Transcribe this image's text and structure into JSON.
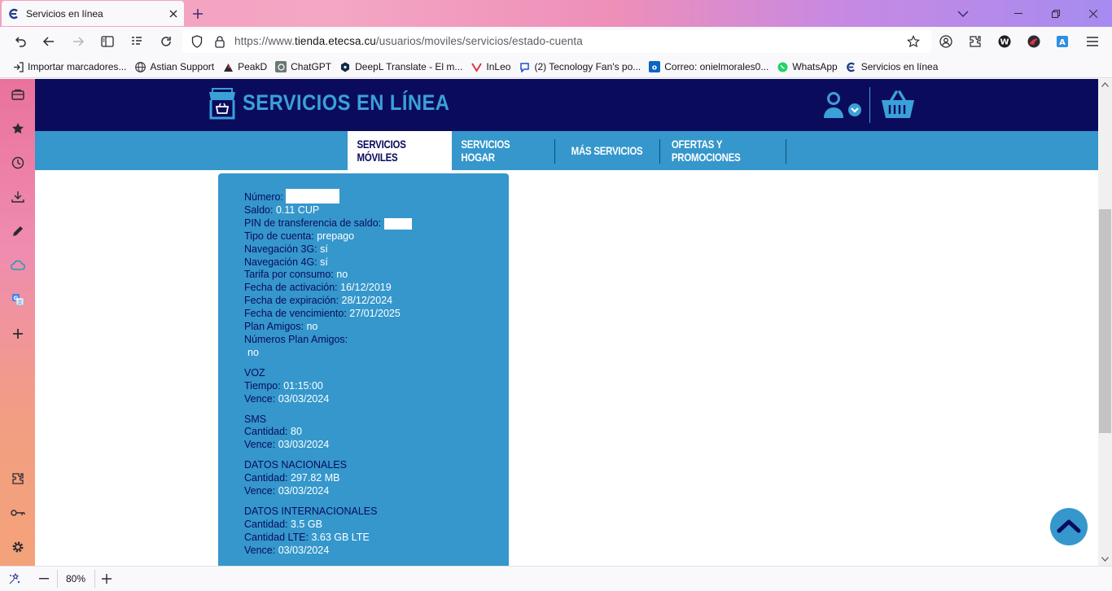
{
  "browser": {
    "tab": {
      "title": "Servicios en línea"
    },
    "address": {
      "scheme": "https://www.",
      "host": "tienda.etecsa.cu",
      "path": "/usuarios/moviles/servicios/estado-cuenta"
    },
    "bookmarks": [
      {
        "label": "Importar marcadores...",
        "icon": "import-icon"
      },
      {
        "label": "Astian Support",
        "icon": "globe-icon"
      },
      {
        "label": "PeakD",
        "icon": "peakd-icon"
      },
      {
        "label": "ChatGPT",
        "icon": "chatgpt-icon"
      },
      {
        "label": "DeepL Translate - El m...",
        "icon": "deepl-icon"
      },
      {
        "label": "InLeo",
        "icon": "inleo-icon"
      },
      {
        "label": "(2) Tecnology Fan's po...",
        "icon": "blog-icon"
      },
      {
        "label": "Correo: onielmorales0...",
        "icon": "outlook-icon"
      },
      {
        "label": "WhatsApp",
        "icon": "whatsapp-icon"
      },
      {
        "label": "Servicios en línea",
        "icon": "etecsa-icon"
      }
    ],
    "zoom": "80%"
  },
  "site": {
    "brand": "SERVICIOS EN LÍNEA",
    "menu": [
      {
        "label": "SERVICIOS MÓVILES",
        "active": true
      },
      {
        "label": "SERVICIOS HOGAR",
        "active": false
      },
      {
        "label": "MÁS SERVICIOS",
        "active": false
      },
      {
        "label": "OFERTAS Y PROMOCIONES",
        "active": false
      }
    ]
  },
  "account": {
    "numero": {
      "label": "Número:",
      "value": ""
    },
    "saldo": {
      "label": "Saldo:",
      "value": "0.11 CUP"
    },
    "pin": {
      "label": "PIN de transferencia de saldo:",
      "value": ""
    },
    "tipo": {
      "label": "Tipo de cuenta:",
      "value": "prepago"
    },
    "nav3g": {
      "label": "Navegación 3G:",
      "value": "sí"
    },
    "nav4g": {
      "label": "Navegación 4G:",
      "value": "sí"
    },
    "tarifa": {
      "label": "Tarifa por consumo:",
      "value": "no"
    },
    "activacion": {
      "label": "Fecha de activación:",
      "value": "16/12/2019"
    },
    "expiracion": {
      "label": "Fecha de expiración:",
      "value": "28/12/2024"
    },
    "vencimiento": {
      "label": "Fecha de vencimiento:",
      "value": "27/01/2025"
    },
    "plan_amigos": {
      "label": "Plan Amigos:",
      "value": "no"
    },
    "numeros_plan_amigos": {
      "label": "Números Plan Amigos:",
      "value": "no"
    },
    "voz": {
      "title": "VOZ",
      "tiempo_label": "Tiempo:",
      "tiempo": "01:15:00",
      "vence_label": "Vence:",
      "vence": "03/03/2024"
    },
    "sms": {
      "title": "SMS",
      "cantidad_label": "Cantidad:",
      "cantidad": "80",
      "vence_label": "Vence:",
      "vence": "03/03/2024"
    },
    "datos_nacionales": {
      "title": "DATOS NACIONALES",
      "cantidad_label": "Cantidad:",
      "cantidad": "297.82 MB",
      "vence_label": "Vence:",
      "vence": "03/03/2024"
    },
    "datos_internacionales": {
      "title": "DATOS INTERNACIONALES",
      "cantidad_label": "Cantidad:",
      "cantidad": "3.5 GB",
      "lte_label": "Cantidad LTE:",
      "lte": "3.63 GB LTE",
      "vence_label": "Vence:",
      "vence": "03/03/2024"
    }
  },
  "colors": {
    "header": "#0b0b5c",
    "accent": "#3597cc",
    "text_dark": "#0b0b5c"
  }
}
